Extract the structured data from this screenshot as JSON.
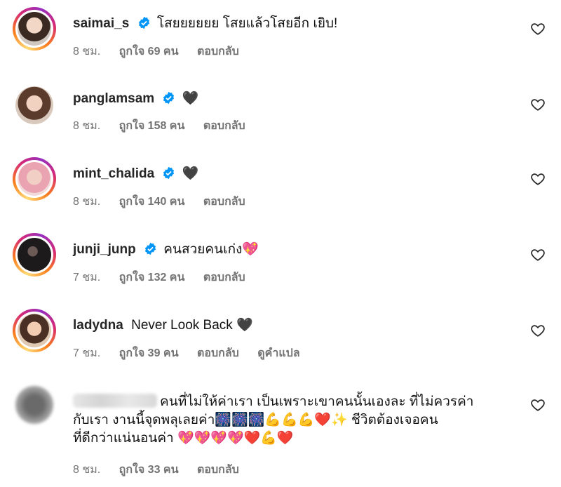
{
  "comments": [
    {
      "username": "saimai_s",
      "verified": true,
      "text": "โสยยยยยย โสยแล้วโสยอีก เยิบ!",
      "time": "8 ชม.",
      "likes": "ถูกใจ 69 คน",
      "reply": "ตอบกลับ"
    },
    {
      "username": "panglamsam",
      "verified": true,
      "text": "🖤",
      "time": "8 ชม.",
      "likes": "ถูกใจ 158 คน",
      "reply": "ตอบกลับ"
    },
    {
      "username": "mint_chalida",
      "verified": true,
      "text": "🖤",
      "time": "8 ชม.",
      "likes": "ถูกใจ 140 คน",
      "reply": "ตอบกลับ"
    },
    {
      "username": "junji_junp",
      "verified": true,
      "text": "คนสวยคนเก่ง💖",
      "time": "7 ชม.",
      "likes": "ถูกใจ 132 คน",
      "reply": "ตอบกลับ"
    },
    {
      "username": "ladydna",
      "verified": false,
      "text": "Never Look Back 🖤",
      "time": "7 ชม.",
      "likes": "ถูกใจ 39 คน",
      "reply": "ตอบกลับ",
      "translate": "ดูคำแปล"
    },
    {
      "username_blurred": true,
      "text_line1": "คนที่ไม่ให้ค่าเรา เป็นเพราะเขาคนนั้นเองละ ที่ไม่ควรค่า",
      "text_line2": "กับเรา งานนี้จุดพลุเลยค่า🎆🎆🎆💪💪💪❤️✨ ชีวิตต้องเจอคน",
      "text_line3": "ที่ดีกว่าแน่นอนค่า 💖💖💖💖❤️💪❤️",
      "time": "8 ชม.",
      "likes": "ถูกใจ 33 คน",
      "reply": "ตอบกลับ"
    }
  ],
  "icons": {
    "like": "heart-outline-icon",
    "verified": "verified-badge-icon"
  },
  "colors": {
    "verified": "#0095f6",
    "meta_text": "#737373",
    "username": "#262626"
  }
}
